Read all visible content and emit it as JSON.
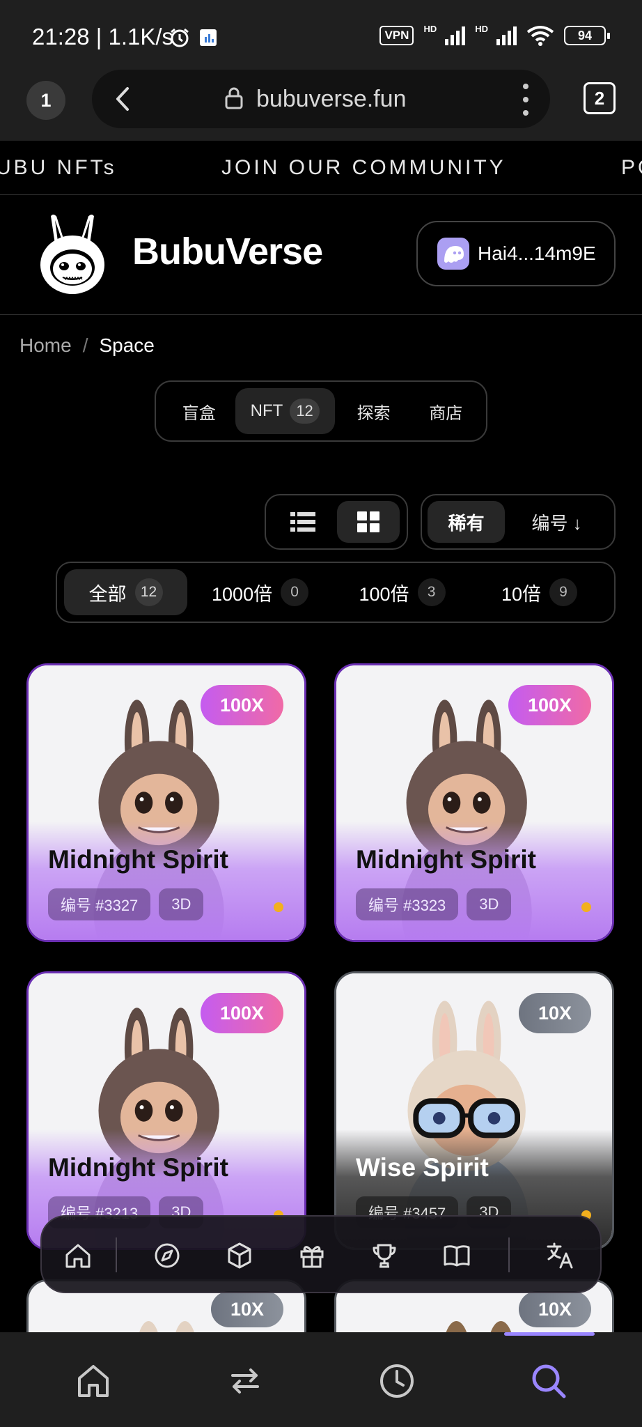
{
  "status_bar": {
    "time": "21:28 | 1.1K/s",
    "vpn": "VPN",
    "hd1": "HD",
    "hd2": "HD",
    "battery": "94"
  },
  "browser": {
    "tab_index": "1",
    "url": "bubuverse.fun",
    "tabs_count": "2"
  },
  "marquee": {
    "items": [
      "UBU NFTs",
      "JOIN OUR COMMUNITY",
      "PO"
    ]
  },
  "header": {
    "brand": "BubuVerse",
    "wallet": "Hai4...14m9E"
  },
  "breadcrumb": {
    "home": "Home",
    "separator": "/",
    "current": "Space"
  },
  "segment_tabs": [
    {
      "label": "盲盒"
    },
    {
      "label": "NFT",
      "count": "12"
    },
    {
      "label": "探索"
    },
    {
      "label": "商店"
    }
  ],
  "sort": {
    "rarity": "稀有",
    "number": "编号 ↓"
  },
  "filters": [
    {
      "label": "全部",
      "count": "12"
    },
    {
      "label": "1000倍",
      "count": "0"
    },
    {
      "label": "100倍",
      "count": "3"
    },
    {
      "label": "10倍",
      "count": "9"
    }
  ],
  "cards": [
    {
      "multiplier": "100X",
      "title": "Midnight Spirit",
      "number": "编号 #3327",
      "type": "3D"
    },
    {
      "multiplier": "100X",
      "title": "Midnight Spirit",
      "number": "编号 #3323",
      "type": "3D"
    },
    {
      "multiplier": "100X",
      "title": "Midnight Spirit",
      "number": "编号 #3213",
      "type": "3D"
    },
    {
      "multiplier": "10X",
      "title": "Wise Spirit",
      "number": "编号 #3457",
      "type": "3D"
    },
    {
      "multiplier": "10X"
    },
    {
      "multiplier": "10X"
    }
  ],
  "colors": {
    "accent": "#9a86ff",
    "card_purple_border": "#6b2fb3",
    "badge_pink": "#e066c8",
    "badge_slate": "#7a808a",
    "rarity_dot": "#f2b01e"
  },
  "dock_icons": [
    "home-icon",
    "compass-icon",
    "cube-icon",
    "gift-icon",
    "trophy-icon",
    "book-icon",
    "translate-icon"
  ],
  "nav_icons": [
    "home-icon",
    "swap-icon",
    "clock-icon",
    "search-icon"
  ]
}
